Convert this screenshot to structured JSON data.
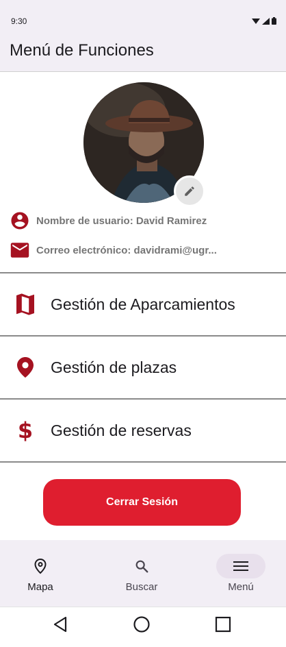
{
  "status": {
    "time": "9:30",
    "icons": [
      "wifi-icon",
      "signal-icon",
      "battery-icon"
    ]
  },
  "appbar": {
    "title": "Menú de Funciones"
  },
  "profile": {
    "avatar": "profile-photo",
    "user_label": "Nombre de usuario: David Ramirez",
    "email_label": "Correo electrónico: davidrami@ugr..."
  },
  "menu": {
    "items": [
      {
        "label": "Gestión de Aparcamientos",
        "icon": "map-icon"
      },
      {
        "label": "Gestión de plazas",
        "icon": "location-pin-icon"
      },
      {
        "label": "Gestión de reservas",
        "icon": "dollar-icon"
      }
    ]
  },
  "logout": {
    "label": "Cerrar Sesión"
  },
  "bottom_nav": {
    "items": [
      {
        "label": "Mapa",
        "icon": "location-pin-outline-icon"
      },
      {
        "label": "Buscar",
        "icon": "search-icon"
      },
      {
        "label": "Menú",
        "icon": "hamburger-menu-icon",
        "selected": true
      }
    ]
  },
  "system_nav": [
    "back-icon",
    "home-icon",
    "recents-icon"
  ],
  "colors": {
    "accent": "#a51221",
    "logout": "#df1e2f",
    "appbar_bg": "#f2eef5",
    "nav_selected": "#e8e0ec"
  }
}
